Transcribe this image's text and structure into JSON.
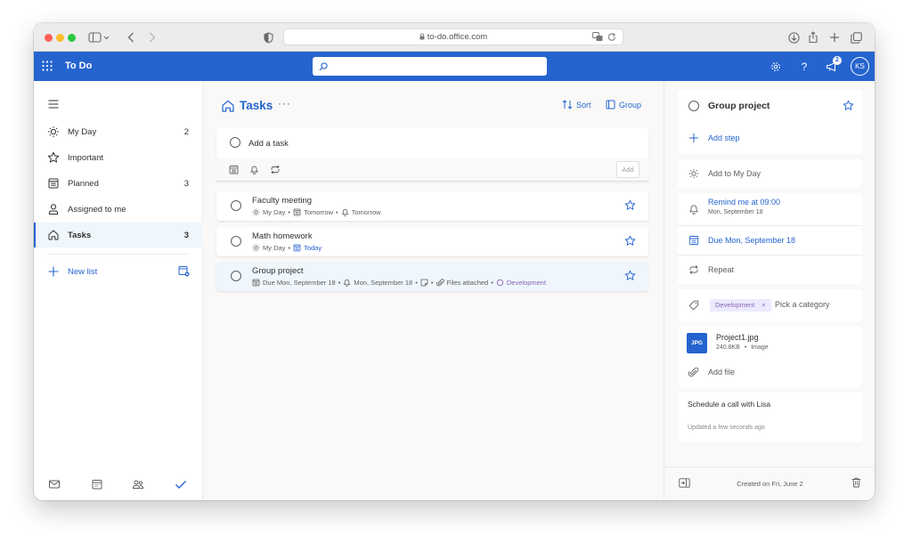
{
  "browser": {
    "url": "to-do.office.com"
  },
  "app": {
    "title": "To Do",
    "search_placeholder": "",
    "notification_count": "2",
    "avatar_initials": "KS"
  },
  "sidebar": {
    "items": [
      {
        "label": "My Day",
        "count": "2",
        "icon": "sun-icon"
      },
      {
        "label": "Important",
        "count": "",
        "icon": "star-icon"
      },
      {
        "label": "Planned",
        "count": "3",
        "icon": "calendar-grid-icon"
      },
      {
        "label": "Assigned to me",
        "count": "",
        "icon": "person-icon"
      },
      {
        "label": "Tasks",
        "count": "3",
        "icon": "home-icon"
      }
    ],
    "new_list_label": "New list"
  },
  "main": {
    "list_title": "Tasks",
    "sort_label": "Sort",
    "group_label": "Group",
    "add_task_placeholder": "Add a task",
    "add_button_label": "Add",
    "tasks": [
      {
        "title": "Faculty meeting",
        "meta": [
          "My Day",
          "Tomorrow",
          "Tomorrow"
        ]
      },
      {
        "title": "Math homework",
        "meta": [
          "My Day",
          "Today"
        ]
      },
      {
        "title": "Group project",
        "meta": [
          "Due Mon, September 18",
          "Mon, September 18",
          "Files attached",
          "Development"
        ]
      }
    ]
  },
  "details": {
    "title": "Group project",
    "add_step": "Add step",
    "add_to_my_day": "Add to My Day",
    "remind_me": "Remind me at 09:00",
    "remind_date": "Mon, September 18",
    "due_date": "Due Mon, September 18",
    "repeat": "Repeat",
    "category_tag": "Development",
    "category_tag_remove": "×",
    "pick_category": "Pick a category",
    "file_type": "JPG",
    "file_name": "Project1.jpg",
    "file_size": "240.8KB",
    "file_kind": "Image",
    "add_file": "Add file",
    "note": "Schedule a call with Lisa",
    "updated": "Updated a few seconds ago",
    "created": "Created on Fri, June 2"
  },
  "colors": {
    "accent": "#2564cf",
    "category": "#8764b8"
  }
}
